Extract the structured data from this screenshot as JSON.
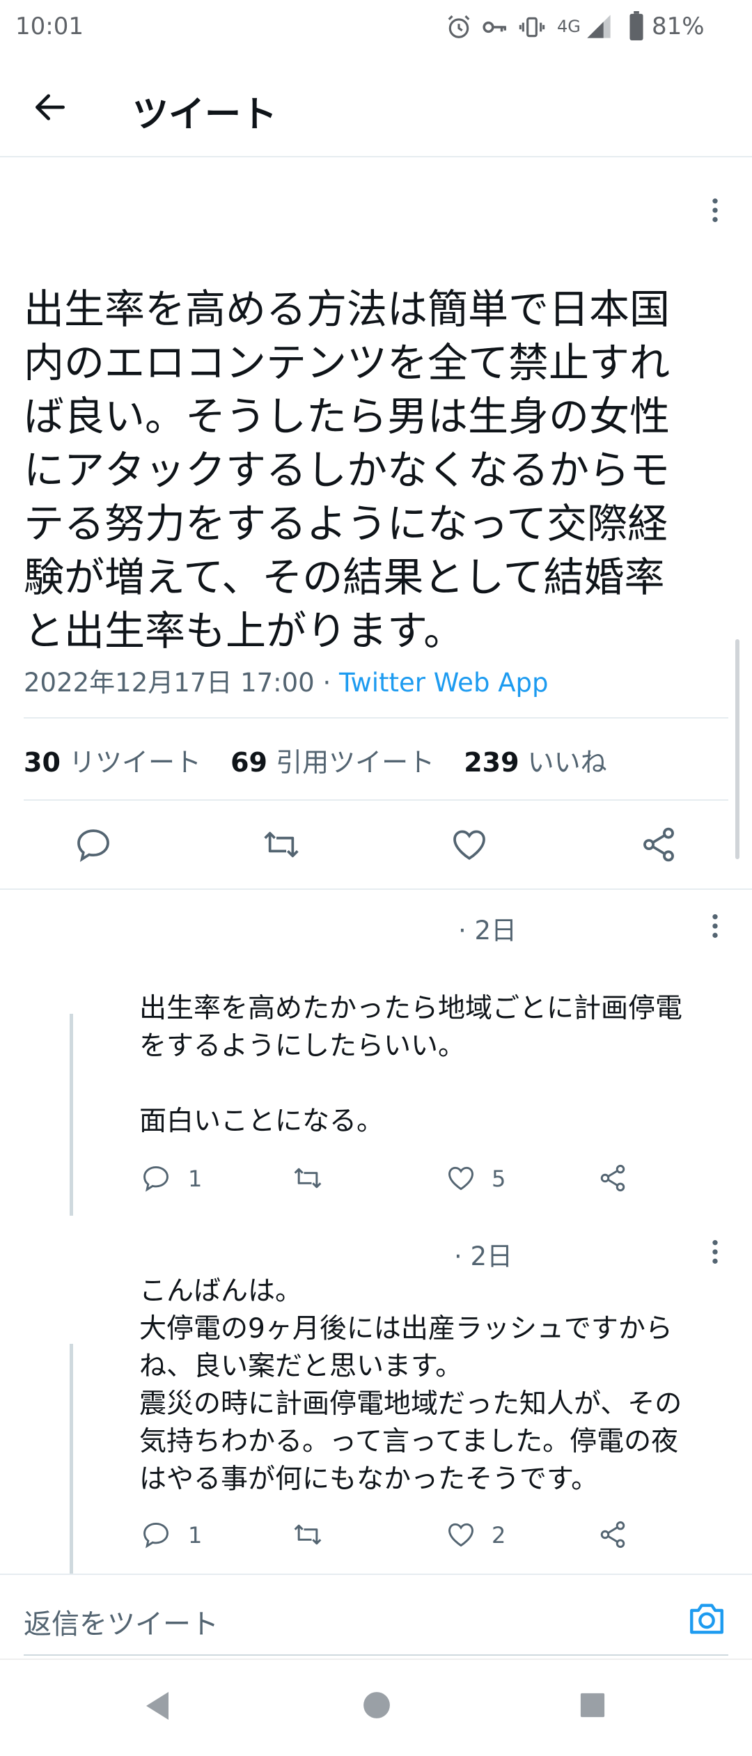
{
  "status_bar": {
    "time": "10:01",
    "network": "4G",
    "battery": "81%"
  },
  "header": {
    "title": "ツイート"
  },
  "tweet": {
    "text_lines": [
      "出生率を高める方法は簡単で日本国",
      "内のエロコンテンツを全て禁止すれ",
      "ば良い。そうしたら男は生身の女性",
      "にアタックするしかなくなるからモ",
      "テる努力をするようになって交際経",
      "験が増えて、その結果として結婚率",
      "と出生率も上がります。"
    ],
    "date": "2022年12月17日 17:00 · ",
    "source": "Twitter Web App",
    "stats": {
      "retweets_count": "30",
      "retweets_label": "リツイート",
      "quotes_count": "69",
      "quotes_label": "引用ツイート",
      "likes_count": "239",
      "likes_label": "いいね"
    }
  },
  "replies": [
    {
      "time": "· 2日",
      "lines": [
        "出生率を高めたかったら地域ごとに計画停電",
        "をするようにしたらいい。",
        "",
        "面白いことになる。"
      ],
      "reply_count": "1",
      "like_count": "5"
    },
    {
      "time": "· 2日",
      "lines": [
        "こんばんは。",
        "大停電の9ヶ月後には出産ラッシュですから",
        "ね、良い案だと思います。",
        "震災の時に計画停電地域だった知人が、その",
        "気持ちわかる。って言ってました。停電の夜",
        "はやる事が何にもなかったそうです。"
      ],
      "reply_count": "1",
      "like_count": "2"
    }
  ],
  "composer": {
    "placeholder": "返信をツイート"
  },
  "colors": {
    "accent": "#1d9bf0",
    "muted": "#536471",
    "text": "#0f1419",
    "divider": "#e6ecf0"
  }
}
